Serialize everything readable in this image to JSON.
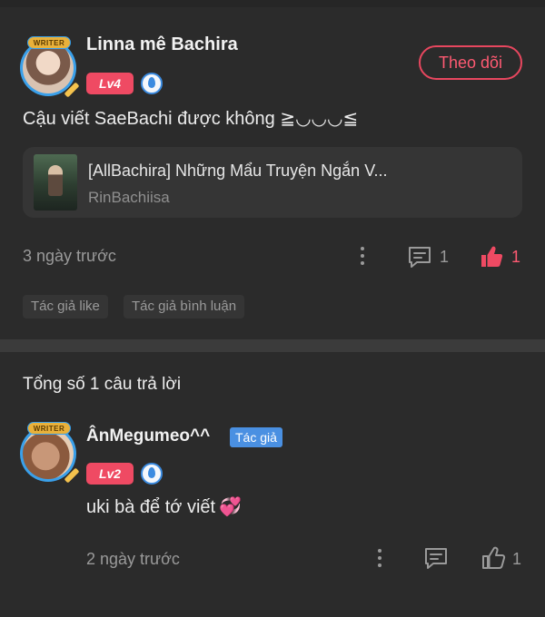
{
  "comment": {
    "writer_badge": "WRITER",
    "username": "Linna mê Bachira",
    "level": "Lv4",
    "follow_label": "Theo dõi",
    "text": "Cậu viết SaeBachi được không ≧◡◡◡≦",
    "book": {
      "title": "[AllBachira] Những Mẩu Truyện Ngắn V...",
      "author": "RinBachiisa"
    },
    "time": "3 ngày trước",
    "reply_count": "1",
    "like_count": "1",
    "tags": [
      "Tác giả like",
      "Tác giả bình luận"
    ]
  },
  "replies": {
    "total_label": "Tổng số 1 câu trả lời",
    "items": [
      {
        "writer_badge": "WRITER",
        "username": "ÂnMegumeo^^",
        "author_badge": "Tác giả",
        "level": "Lv2",
        "text": "uki bà để tớ viết",
        "emoji": "💞",
        "time": "2 ngày trước",
        "like_count": "1"
      }
    ]
  },
  "colors": {
    "background": "#2b2b2b",
    "accent": "#ef4a63",
    "author_badge": "#4a90e2"
  }
}
